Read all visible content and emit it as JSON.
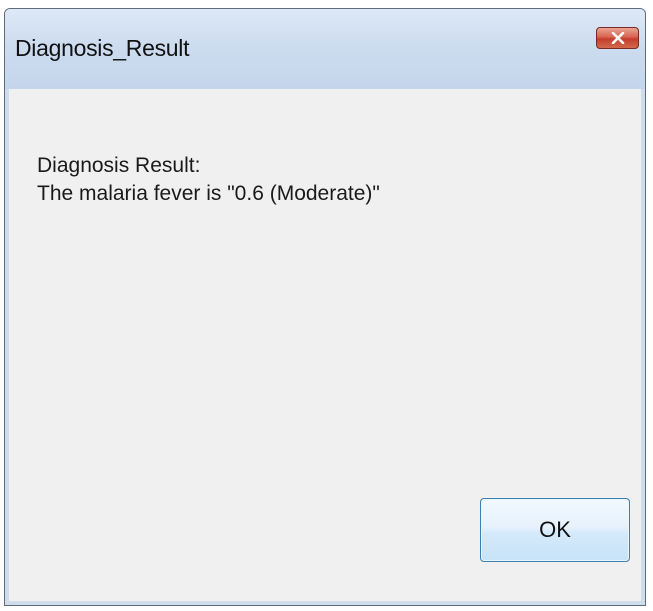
{
  "window": {
    "title": "Diagnosis_Result",
    "close_icon": "close-icon"
  },
  "message": {
    "line1": "Diagnosis Result:",
    "line2": "The malaria fever is \"0.6 (Moderate)\""
  },
  "buttons": {
    "ok_label": "OK"
  },
  "colors": {
    "titlebar": "#cddcef",
    "close_button": "#d2604a",
    "body": "#f0f0f0",
    "ok_border": "#3c7fb1"
  }
}
